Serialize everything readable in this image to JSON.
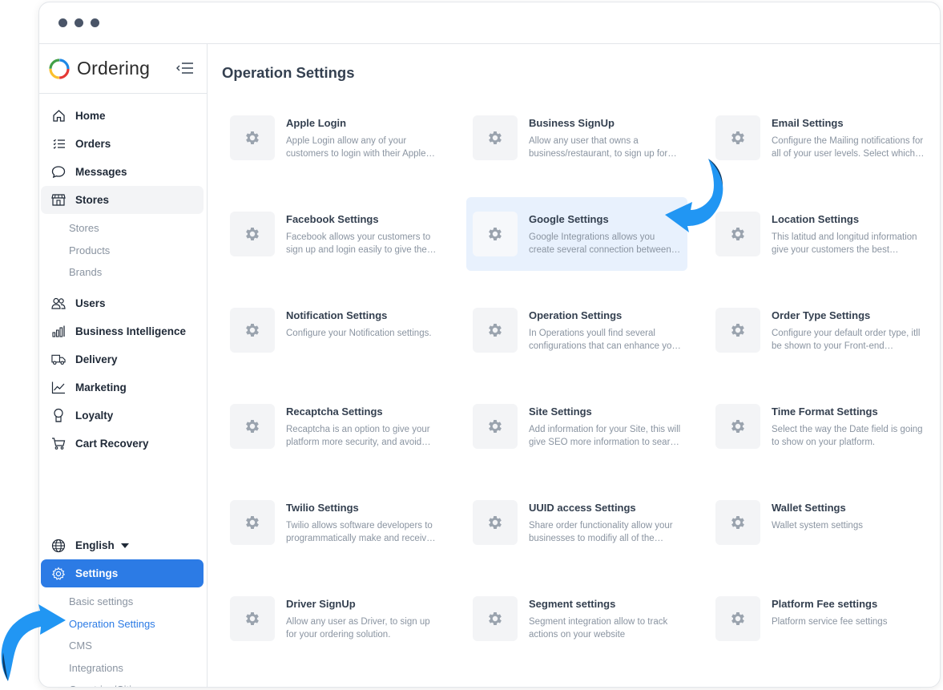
{
  "brand": {
    "name": "Ordering"
  },
  "sidebar": {
    "items": [
      {
        "label": "Home",
        "icon": "home-icon"
      },
      {
        "label": "Orders",
        "icon": "orders-list-icon"
      },
      {
        "label": "Messages",
        "icon": "chat-bubble-icon"
      },
      {
        "label": "Stores",
        "icon": "store-icon"
      }
    ],
    "stores_sub": [
      "Stores",
      "Products",
      "Brands"
    ],
    "items2": [
      {
        "label": "Users",
        "icon": "users-icon"
      },
      {
        "label": "Business Intelligence",
        "icon": "bar-chart-icon"
      },
      {
        "label": "Delivery",
        "icon": "truck-icon"
      },
      {
        "label": "Marketing",
        "icon": "line-chart-icon"
      },
      {
        "label": "Loyalty",
        "icon": "medal-icon"
      },
      {
        "label": "Cart Recovery",
        "icon": "cart-icon"
      }
    ],
    "language": "English",
    "settings_label": "Settings",
    "settings_sub": [
      "Basic settings",
      "Operation Settings",
      "CMS",
      "Integrations",
      "Countries/Cities"
    ]
  },
  "main": {
    "title": "Operation Settings",
    "cards": [
      {
        "title": "Apple Login",
        "desc": "Apple Login allow any of your customers to login with their Apple account."
      },
      {
        "title": "Business SignUp",
        "desc": "Allow any user that owns a business/restaurant, to sign up for your platform."
      },
      {
        "title": "Email Settings",
        "desc": "Configure the Mailing notifications for all of your user levels. Select which ones."
      },
      {
        "title": "Facebook Settings",
        "desc": "Facebook allows your customers to sign up and login easily to give them access."
      },
      {
        "title": "Google Settings",
        "desc": "Google Integrations allows you create several connection between services."
      },
      {
        "title": "Location Settings",
        "desc": "This latitud and longitud information give your customers the best location."
      },
      {
        "title": "Notification Settings",
        "desc": "Configure your Notification settings."
      },
      {
        "title": "Operation Settings",
        "desc": "In Operations youll find several configurations that can enhance your business."
      },
      {
        "title": "Order Type Settings",
        "desc": "Configure your default order type, itll be shown to your Front-end customers."
      },
      {
        "title": "Recaptcha Settings",
        "desc": "Recaptcha is an option to give your platform more security, and avoid spam."
      },
      {
        "title": "Site Settings",
        "desc": "Add information for your Site, this will give SEO more information to search engines."
      },
      {
        "title": "Time Format Settings",
        "desc": "Select the way the Date field is going to show on your platform."
      },
      {
        "title": "Twilio Settings",
        "desc": "Twilio allows software developers to programmatically make and receive calls."
      },
      {
        "title": "UUID access Settings",
        "desc": "Share order functionality allow your businesses to modifiy all of the orders."
      },
      {
        "title": "Wallet Settings",
        "desc": "Wallet system settings"
      },
      {
        "title": "Driver SignUp",
        "desc": "Allow any user as Driver, to sign up for your ordering solution."
      },
      {
        "title": "Segment settings",
        "desc": "Segment integration allow to track actions on your website"
      },
      {
        "title": "Platform Fee settings",
        "desc": "Platform service fee settings"
      }
    ]
  },
  "colors": {
    "accent": "#2c7be5",
    "highlight": "#e8f1fd",
    "arrow_light": "#2196f3",
    "arrow_dark": "#0d3b66"
  }
}
